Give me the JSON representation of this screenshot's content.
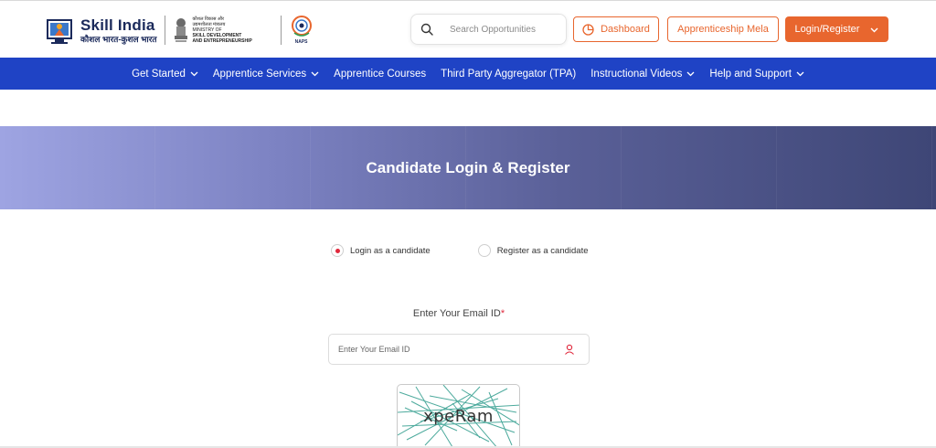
{
  "header": {
    "brand_title": "Skill India",
    "brand_subtitle": "कौशल भारत-कुशल भारत",
    "ministry_line1": "कौशल विकास और",
    "ministry_line2": "उद्यमशीलता मंत्रालय",
    "ministry_line3": "MINISTRY OF",
    "ministry_line4": "SKILL DEVELOPMENT",
    "ministry_line5": "AND ENTREPRENEURSHIP",
    "naps_label": "NAPS",
    "search": {
      "placeholder": "Search Opportunities"
    },
    "dashboard_label": "Dashboard",
    "mela_label": "Apprenticeship Mela",
    "login_label": "Login/Register",
    "accent_color": "#e8662e"
  },
  "nav": {
    "background": "#1f43c5",
    "items": [
      {
        "label": "Get Started",
        "dropdown": true
      },
      {
        "label": "Apprentice Services",
        "dropdown": true
      },
      {
        "label": "Apprentice Courses",
        "dropdown": false
      },
      {
        "label": "Third Party Aggregator (TPA)",
        "dropdown": false
      },
      {
        "label": "Instructional Videos",
        "dropdown": true
      },
      {
        "label": "Help and Support",
        "dropdown": true
      }
    ]
  },
  "banner": {
    "title": "Candidate Login & Register"
  },
  "form": {
    "radio_login": "Login as a candidate",
    "radio_register": "Register as a candidate",
    "selected": "login",
    "email_label": "Enter Your Email ID",
    "email_required": "*",
    "email_placeholder": "Enter Your Email ID",
    "captcha_text": "xpeRam"
  }
}
